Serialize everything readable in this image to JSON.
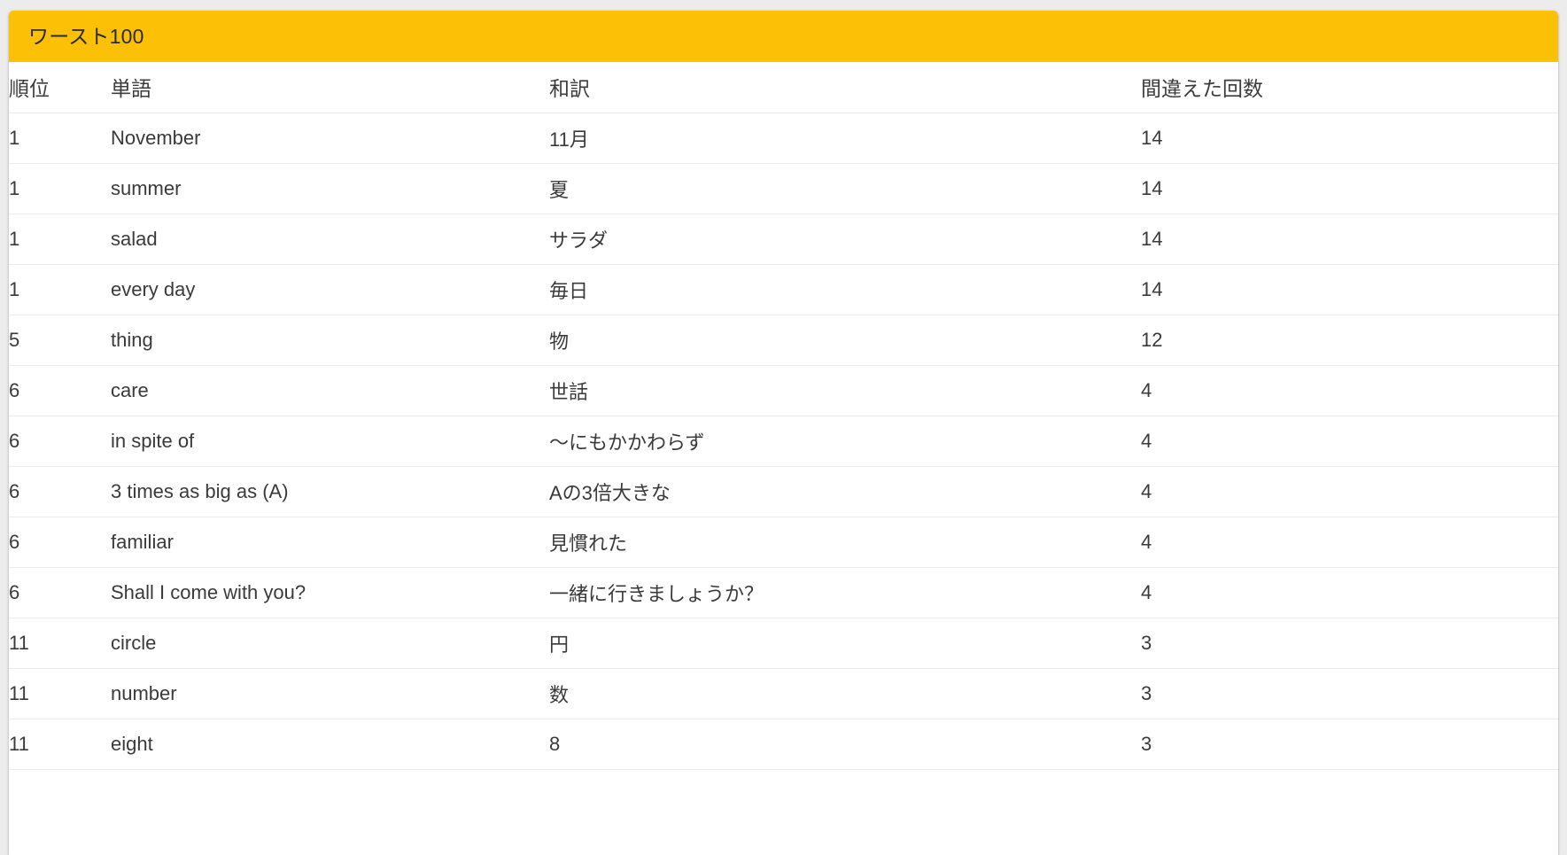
{
  "card": {
    "title": "ワースト100",
    "header_color": "#FCC006"
  },
  "table": {
    "columns": [
      {
        "key": "rank",
        "label": "順位"
      },
      {
        "key": "word",
        "label": "単語"
      },
      {
        "key": "trans",
        "label": "和訳"
      },
      {
        "key": "count",
        "label": "間違えた回数"
      }
    ],
    "rows": [
      {
        "rank": "1",
        "word": "November",
        "trans": "11月",
        "count": "14"
      },
      {
        "rank": "1",
        "word": "summer",
        "trans": "夏",
        "count": "14"
      },
      {
        "rank": "1",
        "word": "salad",
        "trans": "サラダ",
        "count": "14"
      },
      {
        "rank": "1",
        "word": "every day",
        "trans": "毎日",
        "count": "14"
      },
      {
        "rank": "5",
        "word": "thing",
        "trans": "物",
        "count": "12"
      },
      {
        "rank": "6",
        "word": "care",
        "trans": "世話",
        "count": "4"
      },
      {
        "rank": "6",
        "word": "in spite of",
        "trans": "〜にもかかわらず",
        "count": "4"
      },
      {
        "rank": "6",
        "word": "3 times as big as (A)",
        "trans": "Aの3倍大きな",
        "count": "4"
      },
      {
        "rank": "6",
        "word": "familiar",
        "trans": "見慣れた",
        "count": "4"
      },
      {
        "rank": "6",
        "word": "Shall I come with you?",
        "trans": "一緒に行きましょうか？",
        "count": "4"
      },
      {
        "rank": "11",
        "word": "circle",
        "trans": "円",
        "count": "3"
      },
      {
        "rank": "11",
        "word": "number",
        "trans": "数",
        "count": "3"
      },
      {
        "rank": "11",
        "word": "eight",
        "trans": "8",
        "count": "3"
      }
    ]
  }
}
